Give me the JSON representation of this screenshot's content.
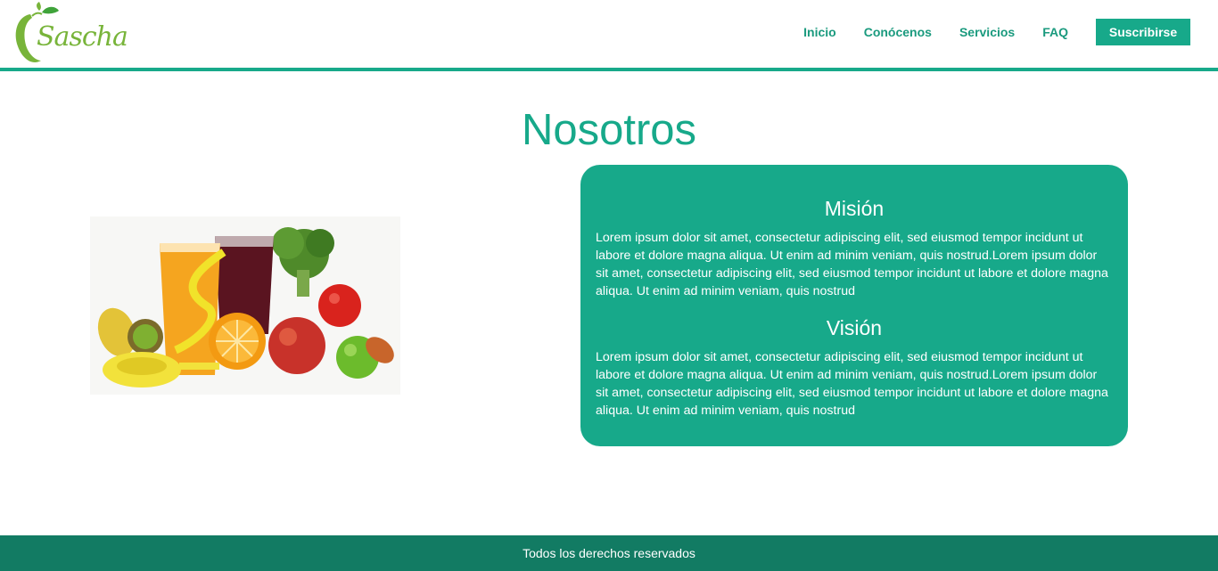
{
  "header": {
    "logo_text": "Sascha",
    "nav": {
      "inicio": "Inicio",
      "conocenos": "Conócenos",
      "servicios": "Servicios",
      "faq": "FAQ"
    },
    "subscribe_label": "Suscribirse"
  },
  "main": {
    "title": "Nosotros",
    "mission": {
      "heading": "Misión",
      "text": "Lorem ipsum dolor sit amet, consectetur adipiscing elit, sed eiusmod tempor incidunt ut labore et dolore magna aliqua. Ut enim ad minim veniam, quis nostrud.Lorem ipsum dolor sit amet, consectetur adipiscing elit, sed eiusmod tempor incidunt ut labore et dolore magna aliqua. Ut enim ad minim veniam, quis nostrud"
    },
    "vision": {
      "heading": "Visión",
      "text": "Lorem ipsum dolor sit amet, consectetur adipiscing elit, sed eiusmod tempor incidunt ut labore et dolore magna aliqua. Ut enim ad minim veniam, quis nostrud.Lorem ipsum dolor sit amet, consectetur adipiscing elit, sed eiusmod tempor incidunt ut labore et dolore magna aliqua. Ut enim ad minim veniam, quis nostrud"
    }
  },
  "footer": {
    "text": "Todos los derechos reservados"
  },
  "colors": {
    "accent": "#17a98a",
    "footer": "#127b63",
    "logo_green": "#78b43a"
  },
  "icons": {
    "logo": "apple-logo-icon",
    "hero": "fruit-juice-measuring-tape-image"
  }
}
